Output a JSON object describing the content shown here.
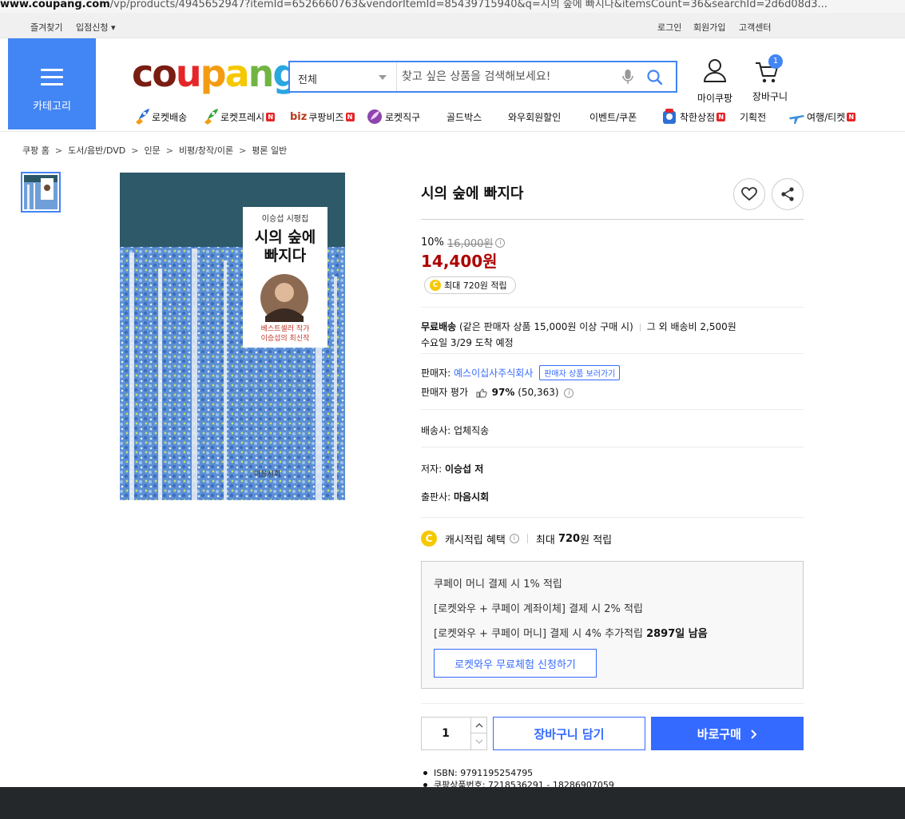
{
  "browser": {
    "url_host": "www.coupang.com",
    "url_path": "/vp/products/4945652947?itemId=6526660763&vendorItemId=85439715940&q=시의 숲에 빠지다&itemsCount=36&searchId=2d6d08d3..."
  },
  "topbar": {
    "bookmark": "즐겨찾기",
    "partner": "입점신청 ▾",
    "login": "로그인",
    "signup": "회원가입",
    "support": "고객센터"
  },
  "category_label": "카테고리",
  "logo": {
    "c": "c",
    "o": "o",
    "u": "u",
    "p": "p",
    "a": "a",
    "n": "n",
    "g": "g"
  },
  "search": {
    "category": "전체",
    "placeholder": "찾고 싶은 상품을 검색해보세요!"
  },
  "header": {
    "my_coupang": "마이쿠팡",
    "cart": "장바구니",
    "cart_count": "1"
  },
  "nav": {
    "rocket_delivery": "로켓배송",
    "rocket_fresh": "로켓프레시",
    "biz_mark": "biz",
    "coupang_biz": "쿠팡비즈",
    "rocket_direct": "로켓직구",
    "goldbox": "골드박스",
    "wow_discount": "와우회원할인",
    "event_coupon": "이벤트/쿠폰",
    "good_store": "착한상점",
    "special": "기획전",
    "travel": "여행/티켓",
    "new_badge": "N"
  },
  "breadcrumb": [
    "쿠팡 홈",
    "도서/음반/DVD",
    "인문",
    "비평/창작/이론",
    "평론 일반"
  ],
  "breadcrumb_sep": ">",
  "book_cover": {
    "series": "이승섭 시평집",
    "title_line1": "시의 숲에",
    "title_line2": "빠지다",
    "tag_line1": "베스트셀러 작가",
    "tag_line2": "이승섭의 최신작"
  },
  "product": {
    "title": "시의 숲에 빠지다",
    "discount_rate": "10%",
    "original_price": "16,000원",
    "price": "14,400원",
    "reward": "최대 720원 적립",
    "coin_mark": "C",
    "info_mark": "i"
  },
  "shipping": {
    "free_label": "무료배송",
    "condition": "(같은 판매자 상품 15,000원 이상 구매 시)",
    "other": "그 외 배송비 2,500원",
    "arrival": "수요일 3/29 도착 예정"
  },
  "seller": {
    "label": "판매자:",
    "name": "예스이십사주식회사",
    "view_products": "판매자 상품 보러가기",
    "rating_label": "판매자 평가",
    "rating": "97%",
    "rating_count": "(50,363)"
  },
  "carrier": {
    "label": "배송사:",
    "value": "업체직송"
  },
  "author": {
    "label": "저자:",
    "value": "이승섭 저"
  },
  "publisher": {
    "label": "출판사:",
    "value": "마음시회"
  },
  "cash": {
    "label": "캐시적립 혜택",
    "max_prefix": "최대",
    "max_amount": "720",
    "max_suffix": "원 적립"
  },
  "benefits": {
    "line1": "쿠페이 머니 결제 시 1% 적립",
    "line2": "[로켓와우 + 쿠페이 계좌이체] 결제 시 2% 적립",
    "line3": "[로켓와우 + 쿠페이 머니] 결제 시 4% 추가적립",
    "line3_strong": "2897일 남음",
    "trial_button": "로켓와우 무료체험 신청하기"
  },
  "purchase": {
    "quantity": "1",
    "add_to_cart": "장바구니 담기",
    "buy_now": "바로구매"
  },
  "specs": {
    "isbn": "ISBN: 9791195254795",
    "product_no": "쿠팡상품번호: 7218536291 - 18286907059"
  },
  "colors": {
    "brand_blue": "#4285f4",
    "button_blue": "#346aff",
    "price_red": "#ae0000",
    "coin_yellow": "#f6c800",
    "badge_red": "#e52528"
  }
}
